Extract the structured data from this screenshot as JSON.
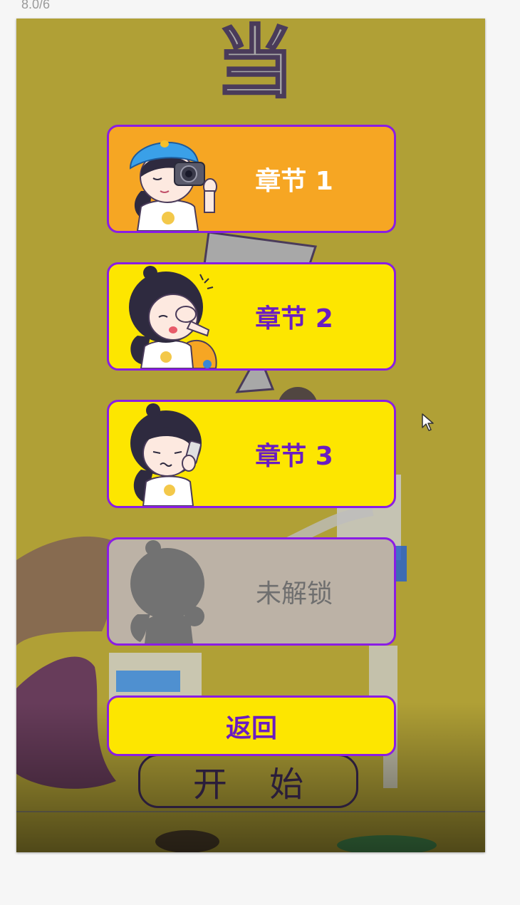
{
  "page_counter": "8.0/6",
  "background": {
    "title_glyph": "当",
    "start_label": "开 始"
  },
  "chapters": [
    {
      "label": "章节 1",
      "status": "unlocked",
      "bg_color": "#f6a623",
      "text_color": "#ffffff",
      "avatar": "girl-with-camera-icon"
    },
    {
      "label": "章节 2",
      "status": "unlocked",
      "bg_color": "#fde600",
      "text_color": "#6a1cc2",
      "avatar": "girl-crying-icon"
    },
    {
      "label": "章节 3",
      "status": "unlocked",
      "bg_color": "#fde600",
      "text_color": "#6a1cc2",
      "avatar": "girl-on-phone-icon"
    },
    {
      "label": "未解锁",
      "status": "locked",
      "bg_color": "#bcb2a6",
      "text_color": "#6f6f6f",
      "avatar": "girl-silhouette-icon"
    }
  ],
  "back_button": {
    "label": "返回"
  },
  "colors": {
    "card_border": "#8a1de4",
    "background": "#b0a036"
  }
}
